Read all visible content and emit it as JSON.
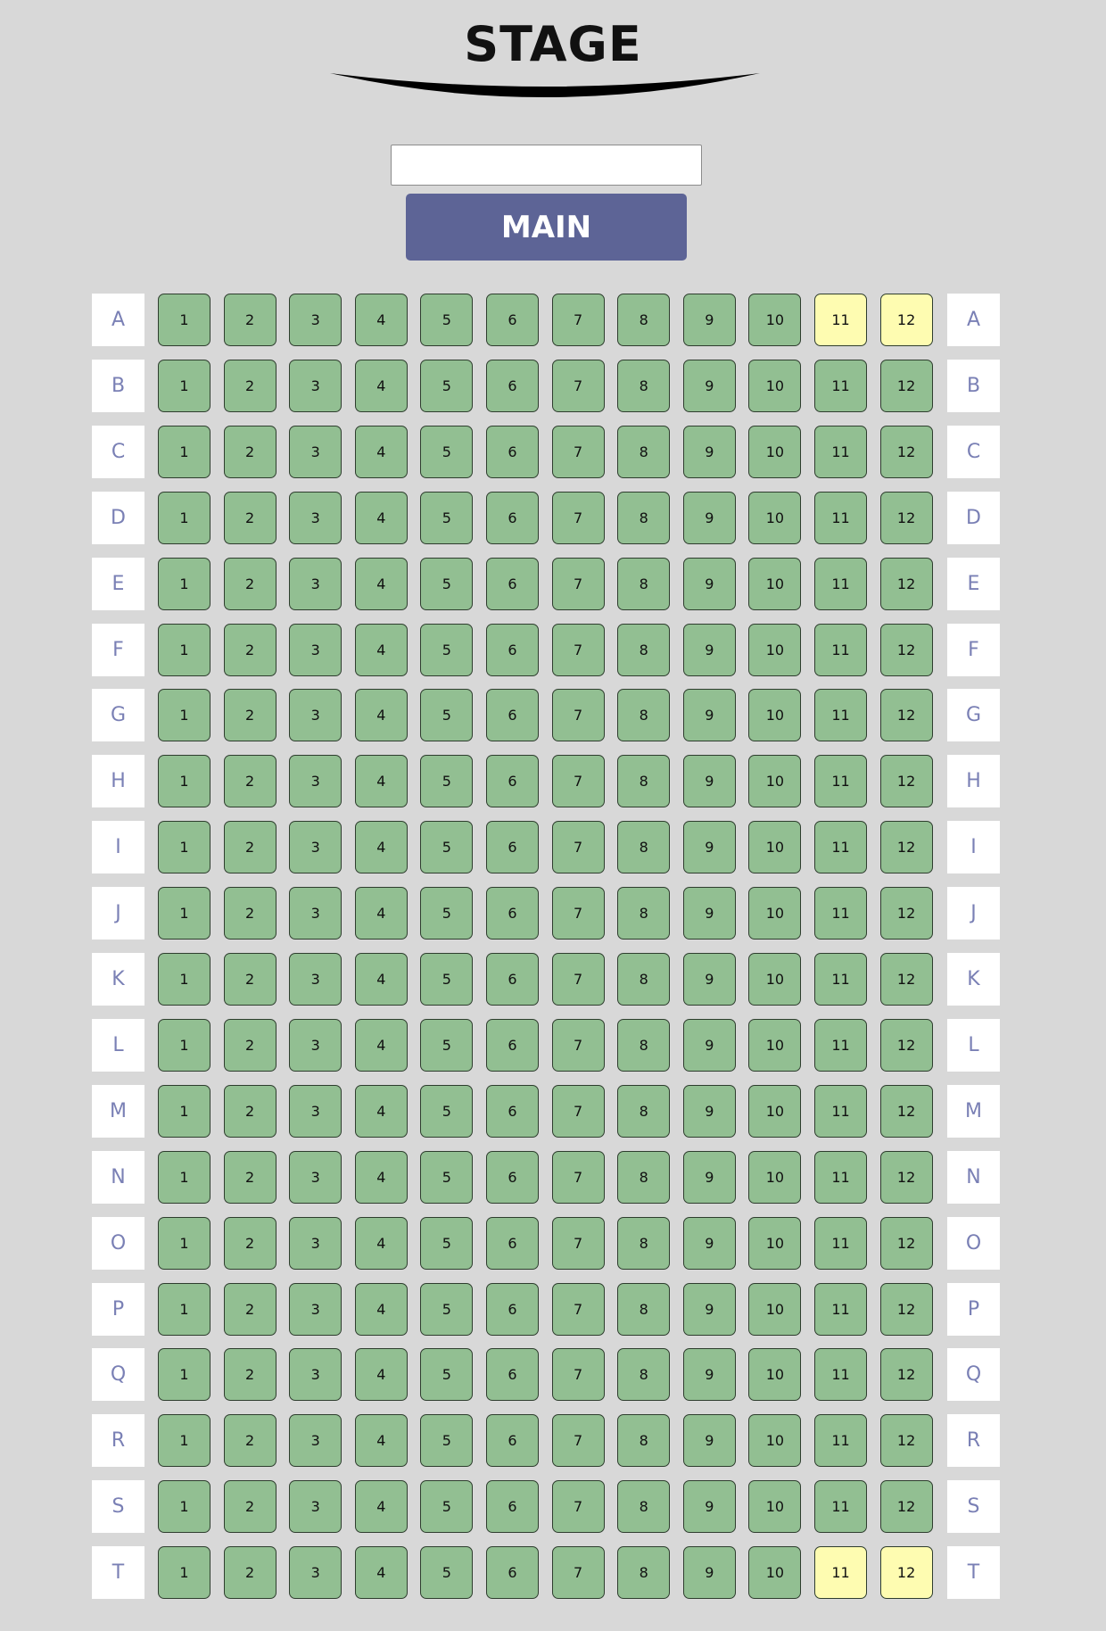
{
  "stage": {
    "title": "STAGE"
  },
  "name_input": {
    "value": "",
    "placeholder": ""
  },
  "main_button": {
    "label": "MAIN"
  },
  "colors": {
    "background": "#d8d8d8",
    "seat_available": "#92bf92",
    "seat_selected": "#fefcb1",
    "row_label_text": "#7a80b5",
    "main_button": "#5d6496"
  },
  "rows": [
    "A",
    "B",
    "C",
    "D",
    "E",
    "F",
    "G",
    "H",
    "I",
    "J",
    "K",
    "L",
    "M",
    "N",
    "O",
    "P",
    "Q",
    "R",
    "S",
    "T"
  ],
  "seat_numbers": [
    "1",
    "2",
    "3",
    "4",
    "5",
    "6",
    "7",
    "8",
    "9",
    "10",
    "11",
    "12"
  ],
  "selected_seats": [
    "A11",
    "A12",
    "T11",
    "T12"
  ]
}
